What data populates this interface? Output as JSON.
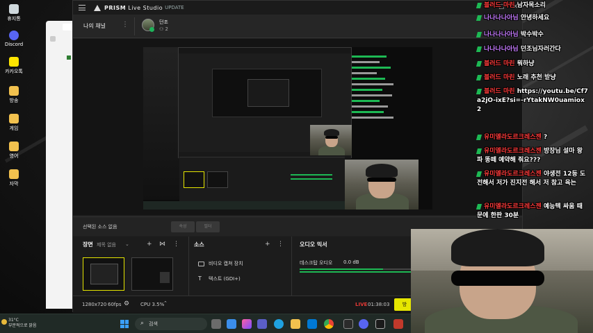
{
  "desktop": {
    "icons": [
      {
        "label": "휴지통"
      },
      {
        "label": "Discord"
      },
      {
        "label": "카카오톡"
      },
      {
        "label": "방송"
      },
      {
        "label": "게임"
      },
      {
        "label": "영어"
      },
      {
        "label": "자막"
      }
    ]
  },
  "prism": {
    "app_name": "PRISM",
    "app_sub": "Live Studio",
    "update_label": "UPDATE",
    "window_controls": [
      "—",
      "▢",
      "✕"
    ],
    "channel_label": "나의 채널",
    "user_name": "던조",
    "viewer_count": "2",
    "no_source_label": "선택된 소스 없음",
    "source_buttons": [
      "속성",
      "필터"
    ],
    "scene_title": "장면",
    "scene_sub": "제목 없음",
    "sources_title": "소스",
    "sources": [
      {
        "label": "비디오 캡쳐 장치"
      },
      {
        "label": "텍스트 (GDI+)"
      }
    ],
    "mixer_title": "오디오 믹서",
    "mixer_channel": "데스크탑 오디오",
    "mixer_db": "0.0 dB",
    "resolution": "1280x720",
    "fps": "60fps",
    "cpu": "CPU 3.5%",
    "live_label": "LIVE",
    "live_time": "01:38:03",
    "end_button": "방"
  },
  "chat": {
    "messages": [
      {
        "nick": "블러드 마린",
        "text": "남자목소리",
        "nick_color": "red"
      },
      {
        "nick": "나나나나아님",
        "text": "안녕하세요",
        "nick_color": "purple"
      },
      {
        "nick": "나나나나아님",
        "text": "박수박수",
        "nick_color": "purple"
      },
      {
        "nick": "나나나나아님",
        "text": "던조님자러간다",
        "nick_color": "purple"
      },
      {
        "nick": "블러드 마린",
        "text": "뭐하냥",
        "nick_color": "red"
      },
      {
        "nick": "블러드 마린",
        "text": "노래 추천 받냥",
        "nick_color": "red"
      },
      {
        "nick": "블러드 마린",
        "text": "https://youtu.be/Cf7a2jO-ixE?si=-rYtakNW0uamiox2",
        "nick_color": "red"
      },
      {
        "nick": "유미엘라도르크레스젠",
        "text": "?",
        "nick_color": "red"
      },
      {
        "nick": "유미엘라도르크레스젠",
        "text": "방장님 설마 왕파 똥떼 예약해 줘요???",
        "nick_color": "red"
      },
      {
        "nick": "유미엘라도르크레스젠",
        "text": "야생전 12등 도전해서 저가 진지전 해서 저 참고 육는",
        "nick_color": "red"
      },
      {
        "nick": "유미엘라도르크레스젠",
        "text": "예능텍 싸움 때문에 한판 30분",
        "nick_color": "red"
      }
    ]
  },
  "taskbar": {
    "weather_temp": "31°C",
    "weather_desc": "부분적으로 맑음",
    "search_placeholder": "검색"
  },
  "colors": {
    "accent_yellow": "#e6e600",
    "live_red": "#e53935",
    "chat_green": "#1db954"
  }
}
